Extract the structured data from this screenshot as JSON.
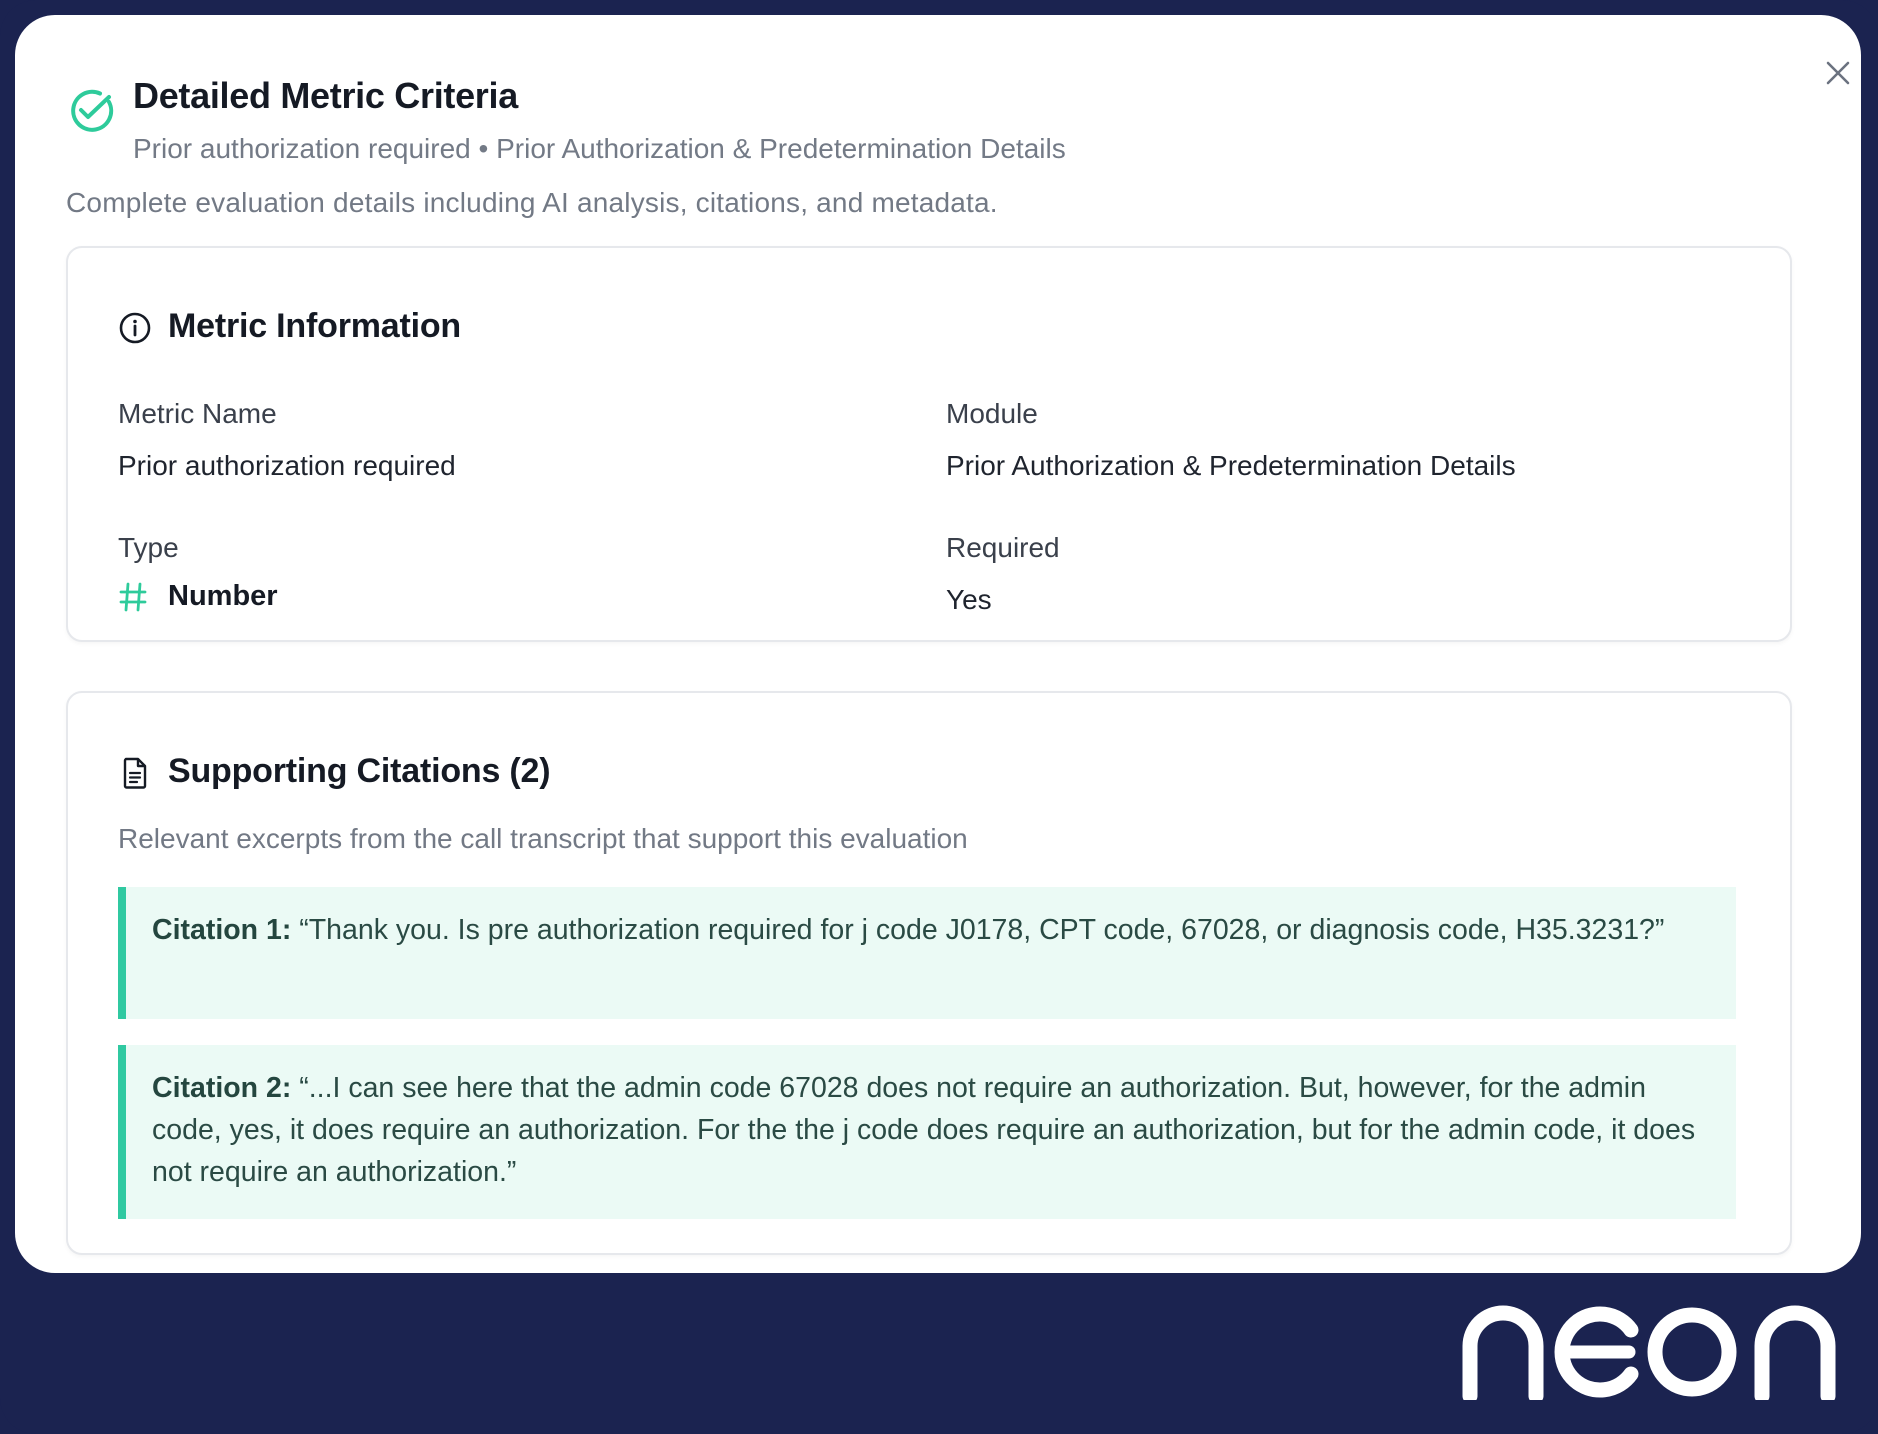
{
  "header": {
    "title": "Detailed Metric Criteria",
    "subtitle": "Prior authorization required • Prior Authorization & Predetermination Details",
    "description": "Complete evaluation details including AI analysis, citations, and metadata.",
    "icon": "check-circle-icon",
    "close_icon": "close-icon"
  },
  "metric_info": {
    "title": "Metric Information",
    "icon": "info-icon",
    "metric_name_label": "Metric Name",
    "metric_name_value": "Prior authorization required",
    "module_label": "Module",
    "module_value": "Prior Authorization & Predetermination Details",
    "type_label": "Type",
    "type_value": "Number",
    "type_icon": "hash-icon",
    "required_label": "Required",
    "required_value": "Yes"
  },
  "citations": {
    "title": "Supporting Citations (2)",
    "icon": "document-icon",
    "description": "Relevant excerpts from the call transcript that support this evaluation",
    "items": [
      {
        "label": "Citation 1:",
        "text": "“Thank you. Is pre authorization required for j code J0178, CPT code, 67028, or diagnosis code, H35.3231?”"
      },
      {
        "label": "Citation 2:",
        "text": "“...I can see here that the admin code 67028 does not require an authorization. But, however, for the admin code, yes, it does require an authorization. For the the j code does require an authorization, but for the admin code, it does not require an authorization.”"
      }
    ]
  },
  "brand": {
    "logo_text": "neon"
  },
  "colors": {
    "accent": "#30c9a1",
    "frame": "#1b2350",
    "citation_bg": "#ebfaf5"
  }
}
